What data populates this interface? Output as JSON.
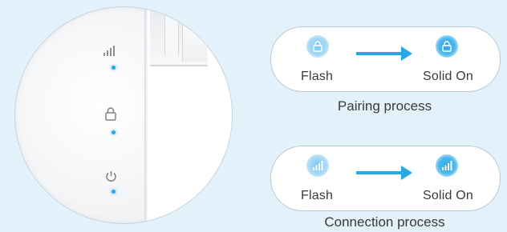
{
  "device": {
    "indicators": [
      "signal-icon",
      "lock-icon",
      "power-icon"
    ],
    "led_color": "#27a8e6"
  },
  "pairing": {
    "from_label": "Flash",
    "to_label": "Solid On",
    "caption": "Pairing process",
    "icon": "lock-icon"
  },
  "connection": {
    "from_label": "Flash",
    "to_label": "Solid On",
    "caption": "Connection process",
    "icon": "signal-icon"
  },
  "colors": {
    "background": "#e3f1fa",
    "accent": "#27a8e6",
    "panel_border": "#b8c9d4"
  }
}
